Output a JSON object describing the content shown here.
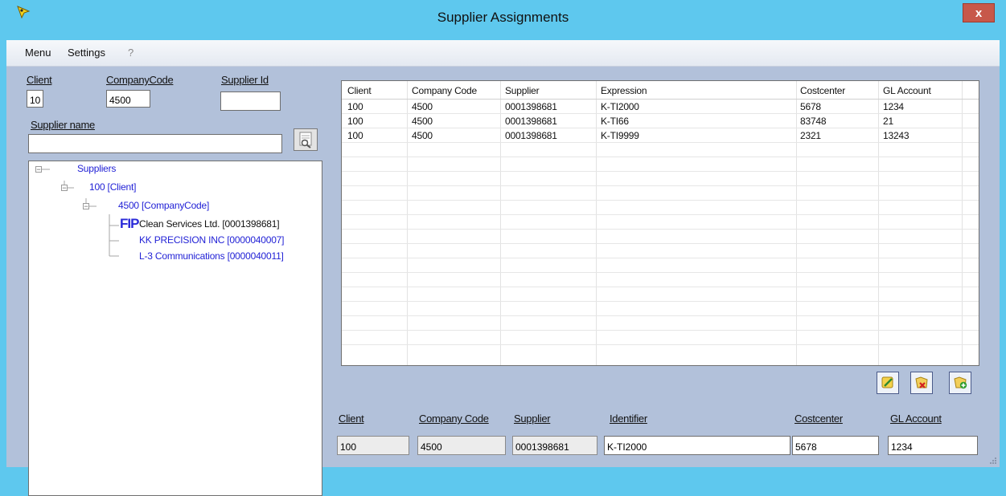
{
  "window": {
    "title": "Supplier Assignments",
    "close_label": "x"
  },
  "menu": {
    "items": [
      "Menu",
      "Settings",
      "?"
    ]
  },
  "filters": {
    "client_label": "Client",
    "client_value": "10",
    "company_code_label": "CompanyCode",
    "company_code_value": "4500",
    "supplier_id_label": "Supplier Id",
    "supplier_id_value": "",
    "supplier_name_label": "Supplier name",
    "supplier_name_value": ""
  },
  "tree": {
    "root": "Suppliers",
    "client": "100 [Client]",
    "company": "4500 [CompanyCode]",
    "suppliers": [
      "Clean Services Ltd. [0001398681]",
      "KK PRECISION INC [0000040007]",
      "L-3 Communications [0000040011]"
    ],
    "selected_marker": "FIP"
  },
  "grid": {
    "columns": [
      "Client",
      "Company Code",
      "Supplier",
      "Expression",
      "Costcenter",
      "GL Account"
    ],
    "rows": [
      [
        "100",
        "4500",
        "0001398681",
        "K-TI2000",
        "5678",
        "1234"
      ],
      [
        "100",
        "4500",
        "0001398681",
        "K-TI66",
        "83748",
        "21"
      ],
      [
        "100",
        "4500",
        "0001398681",
        "K-TI9999",
        "2321",
        "13243"
      ]
    ]
  },
  "detail": {
    "client_label": "Client",
    "client_value": "100",
    "company_code_label": "Company Code",
    "company_code_value": "4500",
    "supplier_label": "Supplier",
    "supplier_value": "0001398681",
    "identifier_label": "Identifier",
    "identifier_value": "K-TI2000",
    "costcenter_label": "Costcenter",
    "costcenter_value": "5678",
    "gl_account_label": "GL Account",
    "gl_account_value": "1234"
  },
  "icons": {
    "app": "app-logo-icon",
    "search": "search-list-icon",
    "edit": "edit-icon",
    "delete": "delete-icon",
    "add": "add-icon"
  }
}
